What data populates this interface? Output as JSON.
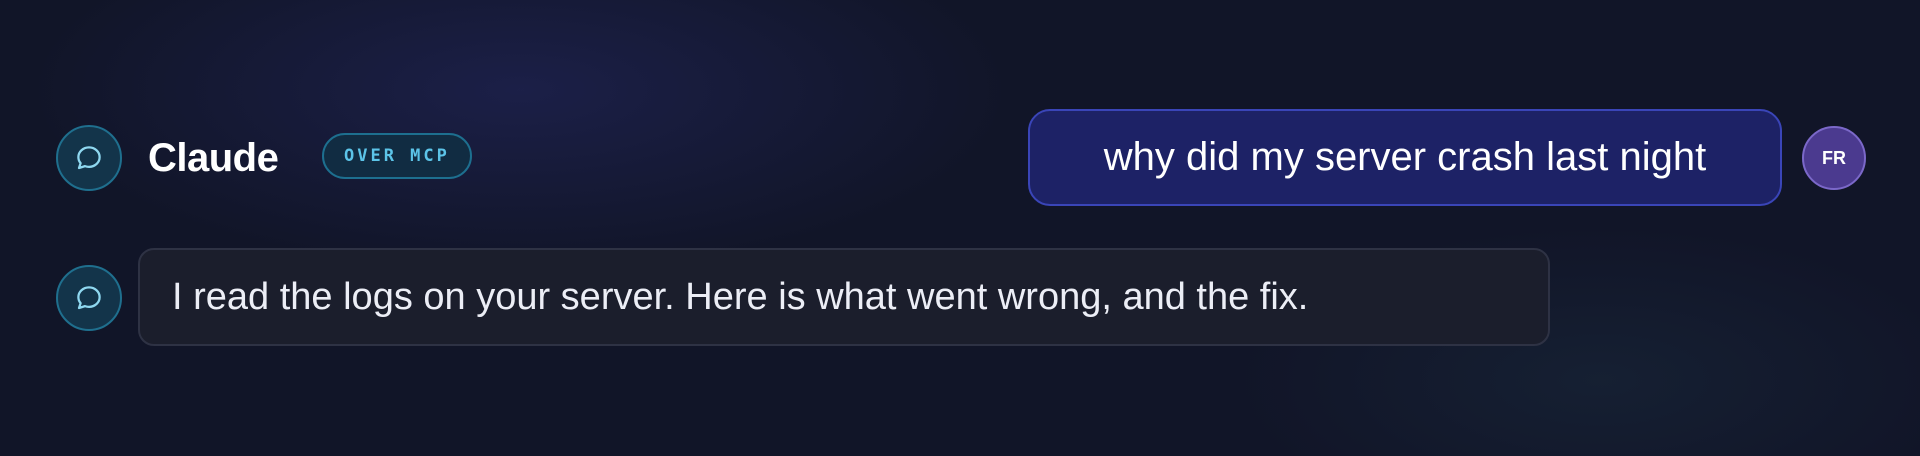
{
  "assistant": {
    "name": "Claude",
    "badge": "OVER MCP",
    "avatar_icon": "chat-bubble-icon",
    "message": "I read the logs on your server. Here is what went wrong, and the fix."
  },
  "user": {
    "initials": "FR",
    "message": "why did my server crash last night"
  },
  "colors": {
    "background": "#111528",
    "user_bubble": "#1d2266",
    "assistant_bubble": "#1b1e2c",
    "badge_text": "#5cc4e8",
    "user_avatar": "#4b3a8f"
  }
}
